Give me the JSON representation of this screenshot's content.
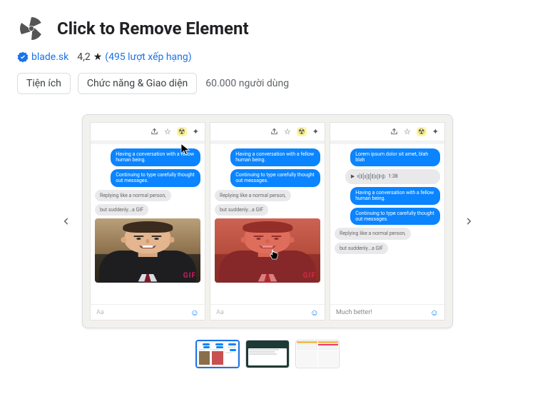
{
  "header": {
    "title": "Click to Remove Element"
  },
  "meta": {
    "developer": "blade.sk",
    "rating": "4,2",
    "ratings_text": "(495 lượt xếp hạng)"
  },
  "chips": {
    "category1": "Tiện ích",
    "category2": "Chức năng & Giao diện",
    "users": "60.000 người dùng"
  },
  "panel_text": {
    "msg1": "Having a conversation with a fellow human being.",
    "msg2": "Continuing to type carefully thought out messages.",
    "reply1": "Replying like a normal person,",
    "reply2": "but suddenly...a GIF",
    "gif_label": "GIF",
    "input_placeholder": "Aa",
    "audio_time": "1:38",
    "panel3_msg1": "Lorem ipsum dolor sit amet, blah blah",
    "panel3_final": "Much better!"
  },
  "icons": {
    "share": "share-icon",
    "star": "star-icon",
    "radiation": "radiation-icon",
    "puzzle": "puzzle-icon",
    "play": "play-icon"
  }
}
